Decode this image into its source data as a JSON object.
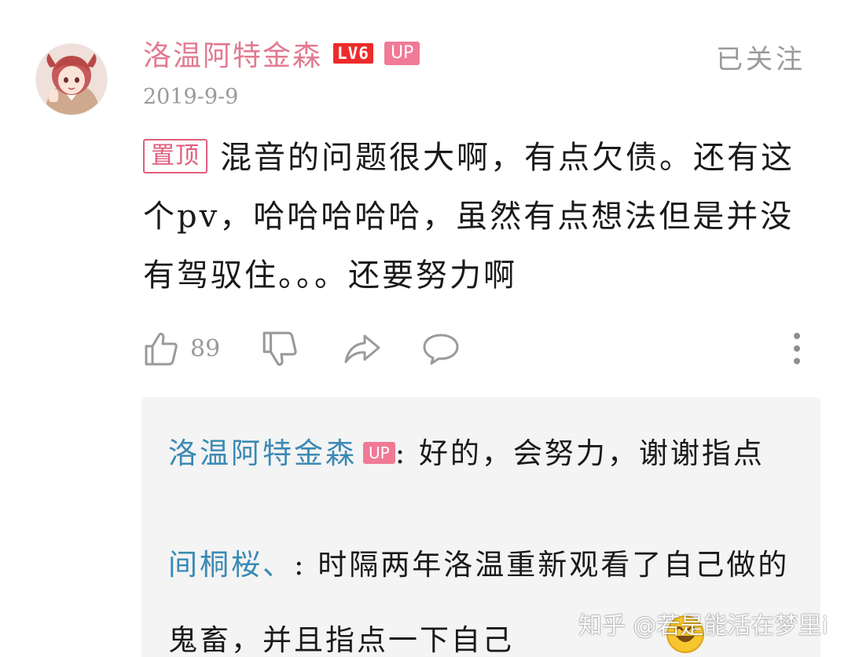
{
  "comment": {
    "author": "洛温阿特金森",
    "level": "LV6",
    "up_badge": "UP",
    "follow_label": "已关注",
    "date": "2019-9-9",
    "pinned_label": "置顶",
    "text": "混音的问题很大啊，有点欠债。还有这个pv，哈哈哈哈哈，虽然有点想法但是并没有驾驭住。。。还要努力啊",
    "like_count": "89"
  },
  "icons": {
    "like": "thumbs-up-icon",
    "dislike": "thumbs-down-icon",
    "share": "share-icon",
    "reply": "comment-bubble-icon",
    "more": "more-vertical-icon",
    "emoji": "smiley-emoji-icon"
  },
  "replies": [
    {
      "author": "洛温阿特金森",
      "badge": "UP",
      "separator": ":",
      "text": "好的，会努力，谢谢指点"
    },
    {
      "author": "间桐桜、",
      "separator": ":",
      "text": "时隔两年洛温重新观看了自己做的鬼畜，并且指点一下自己"
    }
  ],
  "watermark": "知乎 @若是能活在梦里i",
  "colors": {
    "username": "#e27a90",
    "level_badge": "#ee2b2b",
    "up_badge": "#f07a96",
    "pin_tag": "#e05e7e",
    "reply_name": "#3b8ab4",
    "muted_text": "#9a9a9a",
    "reply_bg": "#f4f4f4"
  }
}
